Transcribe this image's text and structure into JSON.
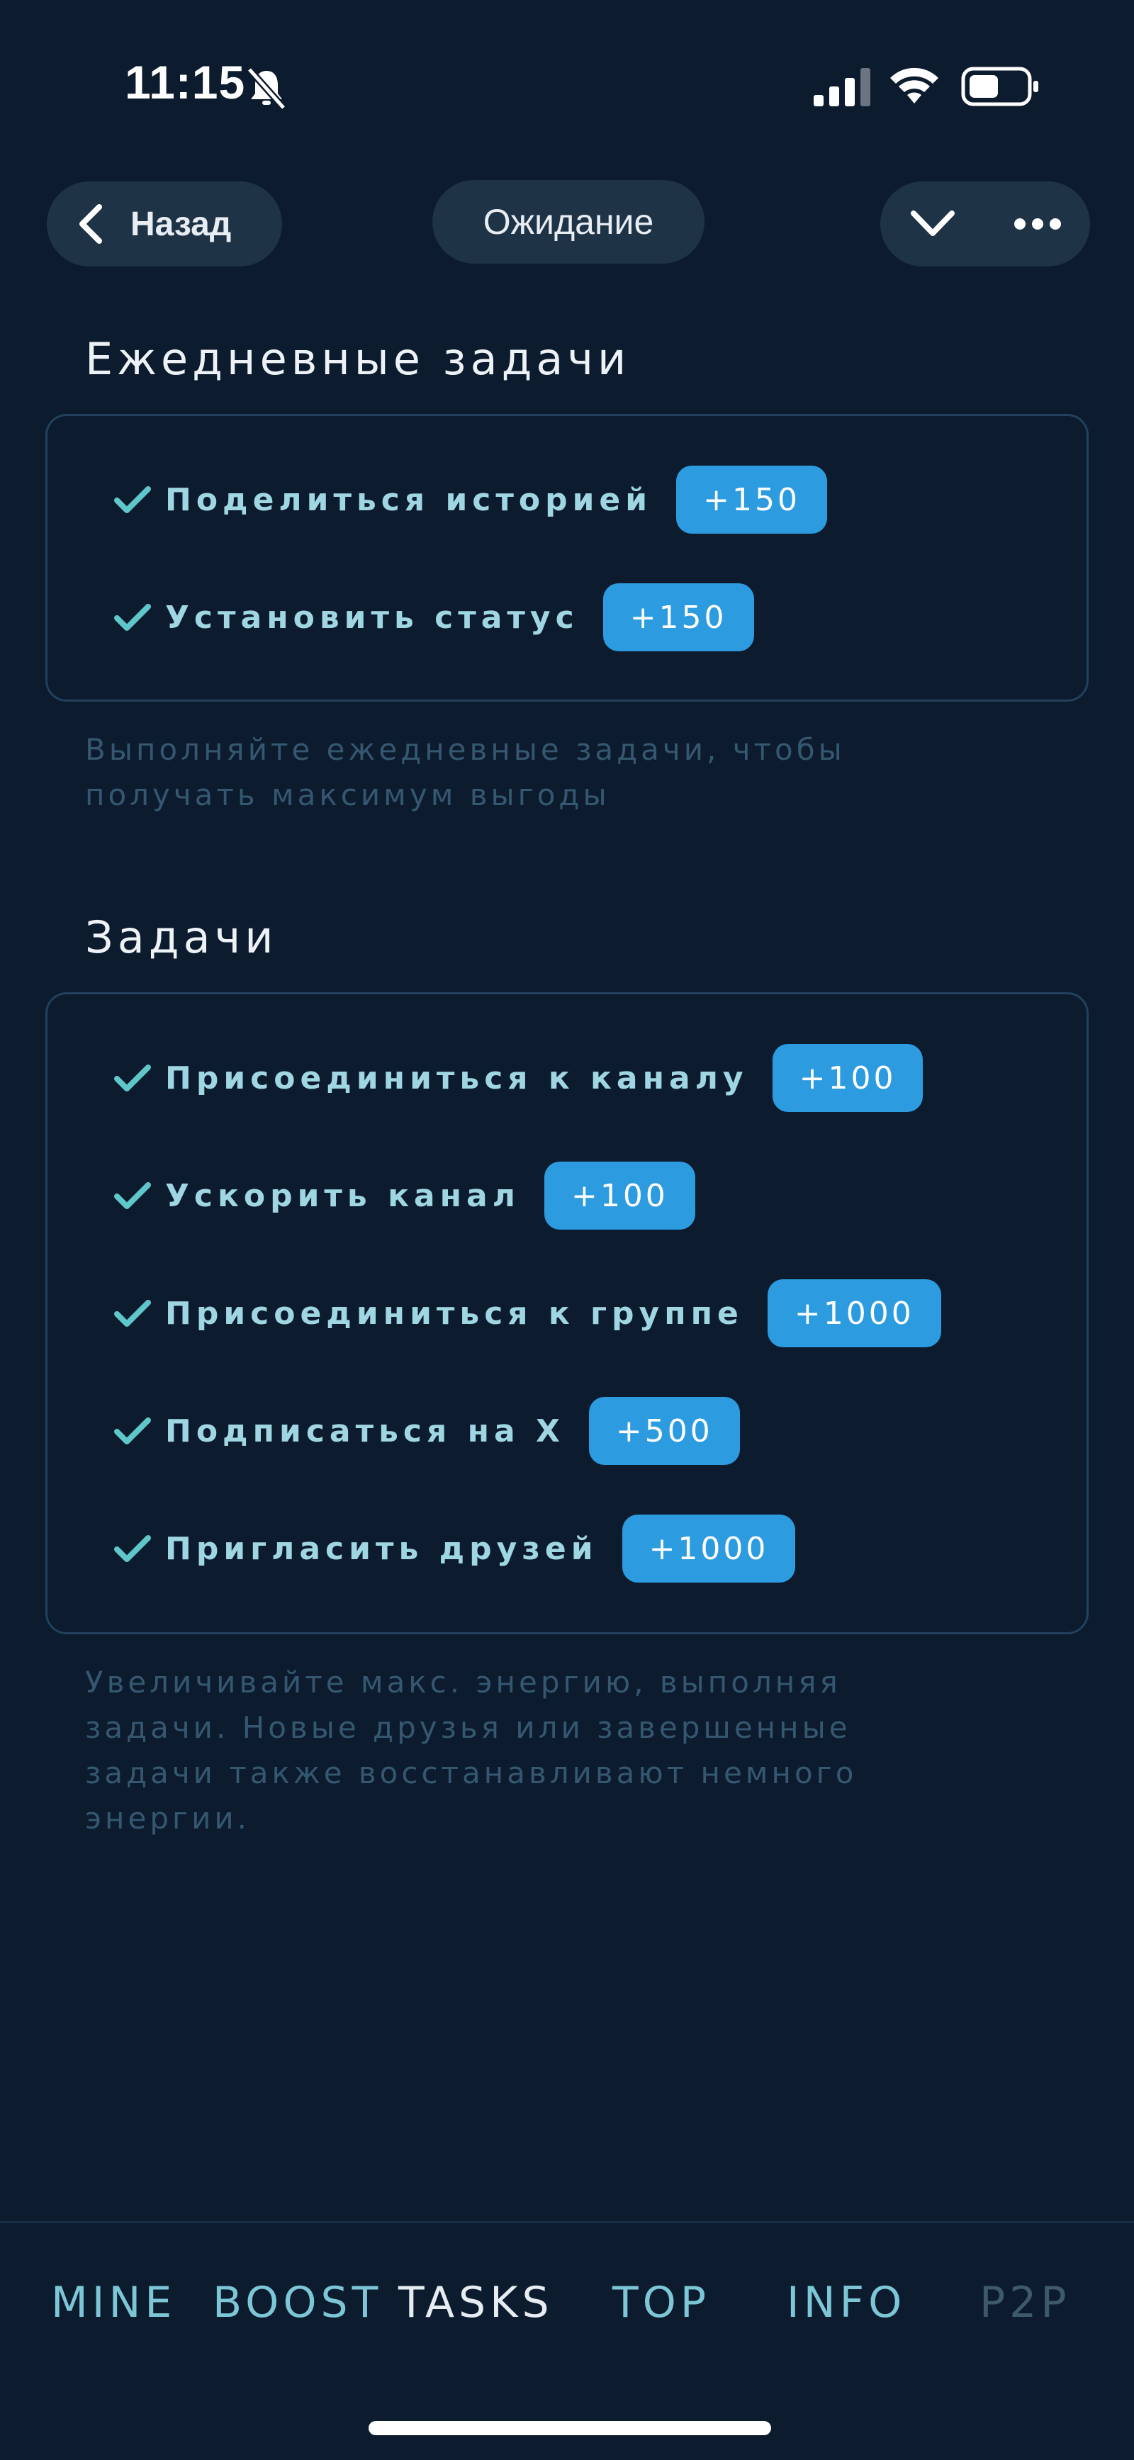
{
  "status_bar": {
    "time": "11:15",
    "icons": [
      "bell-slash-icon",
      "cellular-signal-icon",
      "wifi-icon",
      "battery-icon"
    ]
  },
  "header": {
    "back_label": "Назад",
    "status_label": "Ожидание",
    "icons": [
      "chevron-left-icon",
      "chevron-down-icon",
      "more-dots-icon"
    ]
  },
  "daily": {
    "title": "Ежедневные задачи",
    "tasks": [
      {
        "label": "Поделиться историей",
        "reward": "+150"
      },
      {
        "label": "Установить статус",
        "reward": "+150"
      }
    ],
    "hint": "Выполняйте ежедневные задачи, чтобы получать максимум выгоды"
  },
  "tasks": {
    "title": "Задачи",
    "items": [
      {
        "label": "Присоединиться к каналу",
        "reward": "+100"
      },
      {
        "label": "Ускорить канал",
        "reward": "+100"
      },
      {
        "label": "Присоединиться к группе",
        "reward": "+1000"
      },
      {
        "label": "Подписаться на X",
        "reward": "+500"
      },
      {
        "label": "Пригласить друзей",
        "reward": "+1000"
      }
    ],
    "hint": "Увеличивайте макс. энергию, выполняя задачи. Новые друзья или завершенные задачи также восстанавливают немного энергии."
  },
  "nav": {
    "items": [
      "MINE",
      "BOOST",
      "TASKS",
      "TOP",
      "INFO",
      "P2P"
    ],
    "active": "TASKS"
  },
  "colors": {
    "background": "#0c1b2e",
    "accent": "#2c9be0",
    "task_text": "#9fd6e2",
    "check": "#5fc7c9",
    "nav_text": "#7cc6d6",
    "nav_active": "#e6edf2",
    "nav_disabled": "#3e5a68"
  }
}
